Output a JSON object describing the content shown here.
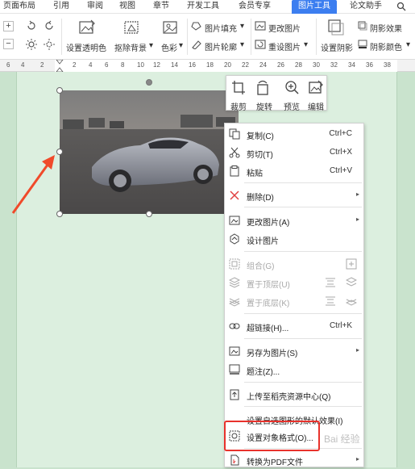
{
  "tabs": [
    {
      "label": "页面布局"
    },
    {
      "label": "引用"
    },
    {
      "label": "审阅"
    },
    {
      "label": "视图"
    },
    {
      "label": "章节"
    },
    {
      "label": "开发工具"
    },
    {
      "label": "会员专享"
    },
    {
      "label": "图片工具"
    },
    {
      "label": "论文助手"
    },
    {
      "label": "Q"
    }
  ],
  "ribbon": {
    "set_transparent": "设置透明色",
    "remove_bg": "抠除背景",
    "color": "色彩",
    "pic_fill": "图片填充",
    "pic_outline": "图片轮廓",
    "change_pic": "更改图片",
    "reset_pic": "重设图片",
    "set_shadow": "设置阴影",
    "shadow_effect": "阴影效果",
    "shadow_color": "阴影颜色"
  },
  "ruler": [
    "6",
    "4",
    "2",
    "2",
    "4",
    "6",
    "8",
    "10",
    "12",
    "14",
    "16",
    "18",
    "20",
    "22",
    "24",
    "26",
    "28",
    "30",
    "32",
    "34",
    "36",
    "38"
  ],
  "mini_toolbar": {
    "crop": "裁剪",
    "rotate": "旋转",
    "preview": "预览",
    "edit": "编辑"
  },
  "menu": {
    "copy": {
      "label": "复制(C)",
      "shortcut": "Ctrl+C"
    },
    "cut": {
      "label": "剪切(T)",
      "shortcut": "Ctrl+X"
    },
    "paste": {
      "label": "粘贴",
      "shortcut": "Ctrl+V"
    },
    "delete": {
      "label": "删除(D)"
    },
    "change_pic": {
      "label": "更改图片(A)"
    },
    "design_pic": {
      "label": "设计图片"
    },
    "group": {
      "label": "组合(G)"
    },
    "bring_top": {
      "label": "置于顶层(U)"
    },
    "send_bottom": {
      "label": "置于底层(K)"
    },
    "hyperlink": {
      "label": "超链接(H)...",
      "shortcut": "Ctrl+K"
    },
    "save_as": {
      "label": "另存为图片(S)"
    },
    "caption": {
      "label": "题注(Z)..."
    },
    "upload": {
      "label": "上传至稻壳资源中心(Q)"
    },
    "default_shape": {
      "label": "设置自选图形的默认效果(I)"
    },
    "format": {
      "label": "设置对象格式(O)..."
    },
    "to_pdf": {
      "label": "转换为PDF文件"
    }
  },
  "watermark": "Bai 经验",
  "colors": {
    "accent": "#3c7ef0",
    "highlight": "#e8322c",
    "arrow": "#f04a2a",
    "page_bg": "#c9e3cd"
  }
}
